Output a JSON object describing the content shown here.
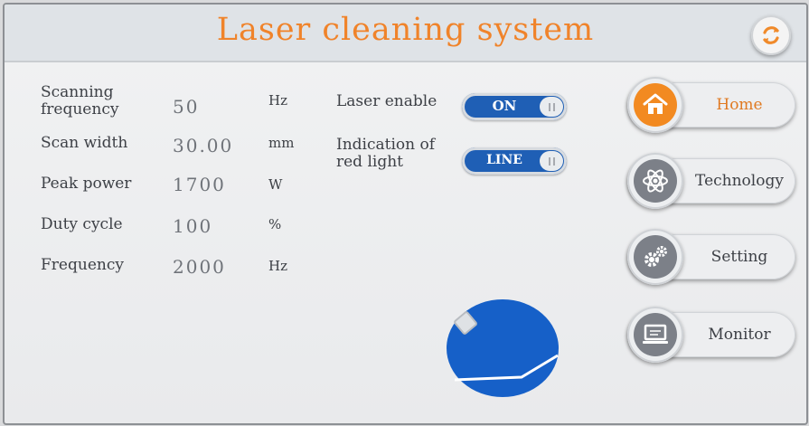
{
  "header": {
    "title": "Laser cleaning system"
  },
  "params": [
    {
      "label": "Scanning frequency",
      "value": "50",
      "unit": "Hz"
    },
    {
      "label": "Scan width",
      "value": "30.00",
      "unit": "mm"
    },
    {
      "label": "Peak power",
      "value": "1700",
      "unit": "W"
    },
    {
      "label": "Duty cycle",
      "value": "100",
      "unit": "%"
    },
    {
      "label": "Frequency",
      "value": "2000",
      "unit": "Hz"
    }
  ],
  "controls": {
    "laser_enable": {
      "label": "Laser enable",
      "state": "ON"
    },
    "red_light": {
      "label": "Indication of red light",
      "state": "LINE"
    }
  },
  "nav": {
    "home": "Home",
    "technology": "Technology",
    "setting": "Setting",
    "monitor": "Monitor"
  },
  "colors": {
    "title": "#f0832a",
    "toggle": "#1f5fb5",
    "active_nav": "#f28a21"
  }
}
